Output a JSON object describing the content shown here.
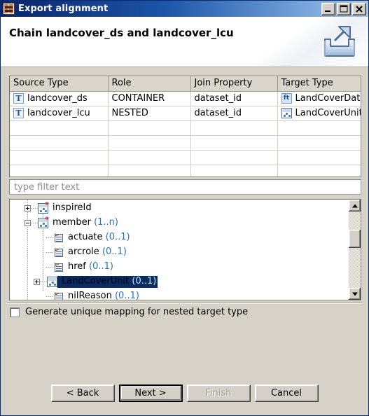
{
  "window": {
    "title": "Export alignment",
    "icon": "export-alignment-icon",
    "controls": {
      "minimize": "minimize-icon",
      "maximize": "maximize-icon",
      "close": "close-icon"
    }
  },
  "header": {
    "title": "Chain landcover_ds and landcover_lcu",
    "icon": "export-wizard-icon"
  },
  "table": {
    "columns": [
      "Source Type",
      "Role",
      "Join Property",
      "Target Type"
    ],
    "rows": [
      {
        "source_type": "landcover_ds",
        "source_icon": "type-icon",
        "role": "CONTAINER",
        "join_property": "dataset_id",
        "target_type": "LandCoverDatа",
        "target_icon": "feature-type-icon"
      },
      {
        "source_type": "landcover_lcu",
        "source_icon": "type-icon",
        "role": "NESTED",
        "join_property": "dataset_id",
        "target_type": "LandCoverUnit",
        "target_icon": "class-icon"
      }
    ],
    "empty_row_count": 4
  },
  "filter": {
    "placeholder": "type filter text",
    "value": ""
  },
  "tree": {
    "nodes": [
      {
        "label": "inspireId",
        "cardinality": "",
        "icon": "class-icon",
        "twisty": "plus",
        "depth": 0,
        "selected": false
      },
      {
        "label": "member",
        "cardinality": "(1..n)",
        "icon": "class-icon",
        "twisty": "minus",
        "depth": 0,
        "selected": false
      },
      {
        "label": "actuate",
        "cardinality": "(0..1)",
        "icon": "attribute-icon",
        "twisty": "none",
        "depth": 1,
        "selected": false
      },
      {
        "label": "arcrole",
        "cardinality": "(0..1)",
        "icon": "attribute-icon",
        "twisty": "none",
        "depth": 1,
        "selected": false
      },
      {
        "label": "href",
        "cardinality": "(0..1)",
        "icon": "attribute-icon",
        "twisty": "none",
        "depth": 1,
        "selected": false
      },
      {
        "label": "LandCoverUnit",
        "cardinality": "(0..1)",
        "icon": "class-icon",
        "twisty": "plus",
        "depth": 1,
        "selected": true
      },
      {
        "label": "nilReason",
        "cardinality": "(0..1)",
        "icon": "attribute-icon",
        "twisty": "none",
        "depth": 1,
        "selected": false
      }
    ],
    "scrollbar": {
      "up": "scroll-up-icon",
      "down": "scroll-down-icon",
      "thumb_position_percent": 22
    }
  },
  "options": {
    "generate_unique_mapping": {
      "label": "Generate unique mapping for nested target type",
      "checked": false
    }
  },
  "buttons": {
    "back": "< Back",
    "next": "Next >",
    "finish": "Finish",
    "cancel": "Cancel"
  },
  "colors": {
    "titlebar_start": "#0a246a",
    "titlebar_end": "#a8c8e8",
    "dialog_bg": "#d6d2c8",
    "selection": "#0b2b63",
    "cardinality_text": "#2a73b8"
  }
}
